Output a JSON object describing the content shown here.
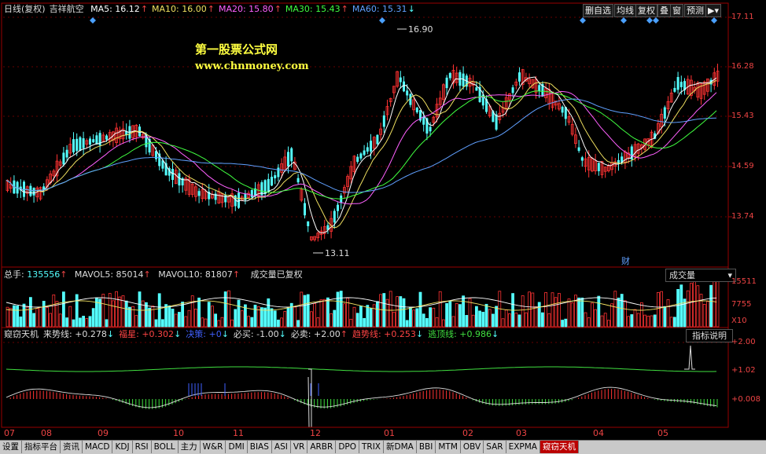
{
  "header": {
    "period": "日线(复权)",
    "stock_name": "吉祥航空",
    "ma": [
      {
        "label": "MA5: 16.12",
        "arrow": "↑",
        "color": "#ffffff"
      },
      {
        "label": "MA10: 16.00",
        "arrow": "↑",
        "color": "#f0e060"
      },
      {
        "label": "MA20: 15.80",
        "arrow": "↑",
        "color": "#ff60ff"
      },
      {
        "label": "MA30: 15.43",
        "arrow": "↑",
        "color": "#40ff40"
      },
      {
        "label": "MA60: 15.31",
        "arrow": "↓",
        "color": "#60a0ff"
      }
    ]
  },
  "toolbar": {
    "remove_watch": "删自选",
    "average_line": "均线",
    "adjust": "复权",
    "overlay": "叠",
    "window": "窗",
    "forecast": "预测",
    "more_arrow": "▶▾"
  },
  "watermark": {
    "title": "第一股票公式网",
    "url": "www.chnmoney.com"
  },
  "price_axis": [
    "17.11",
    "16.28",
    "15.43",
    "14.59",
    "13.74"
  ],
  "price_marks": {
    "high": "16.90",
    "low": "13.11"
  },
  "finance_marker": "财",
  "volume_header": {
    "total_label": "总手: ",
    "total_value": "135556",
    "total_arrow": "↑",
    "mavol5": "MAVOL5: 85014",
    "mavol5_arrow": "↑",
    "mavol10": "MAVOL10: 81807",
    "mavol10_arrow": "↑",
    "note": "成交量已复权"
  },
  "volume_dropdown": {
    "value": "成交量",
    "arrow": "▾"
  },
  "volume_axis": [
    "15511",
    "7755",
    "X10"
  ],
  "indicator_header": [
    {
      "text": "窥窃天机",
      "color": "#dddddd"
    },
    {
      "text": "来势线: +0.278",
      "arrow": "↓",
      "color": "#dddddd"
    },
    {
      "text": "福星: +0.302",
      "arrow": "↓",
      "color": "#ff4444"
    },
    {
      "text": "决策: +0",
      "arrow": "↓",
      "color": "#4060ff"
    },
    {
      "text": "必买: -1.00",
      "arrow": "↓",
      "color": "#dddddd"
    },
    {
      "text": "必卖: +2.00",
      "arrow": "↑",
      "color": "#dddddd"
    },
    {
      "text": "趋势线: +0.253",
      "arrow": "↓",
      "color": "#ff4444"
    },
    {
      "text": "逃顶线: +0.986",
      "arrow": "↓",
      "color": "#40e040"
    }
  ],
  "indicator_button": "指标说明",
  "indicator_axis": [
    "+2.00",
    "+1.02",
    "+0.008"
  ],
  "months": [
    "07",
    "08",
    "09",
    "10",
    "11",
    "12",
    "01",
    "02",
    "03",
    "04",
    "05"
  ],
  "tabs": [
    "设置",
    "指标平台",
    "资讯",
    "MACD",
    "KDJ",
    "RSI",
    "BOLL",
    "主力",
    "W&R",
    "DMI",
    "BIAS",
    "ASI",
    "VR",
    "ARBR",
    "DPO",
    "TRIX",
    "新DMA",
    "BBI",
    "MTM",
    "OBV",
    "SAR",
    "EXPMA",
    "窥窃天机"
  ],
  "active_tab": "窥窃天机",
  "colors": {
    "up": "#ff3333",
    "down": "#54ffff",
    "grid": "#990000",
    "axis_text": "#e44444"
  }
}
